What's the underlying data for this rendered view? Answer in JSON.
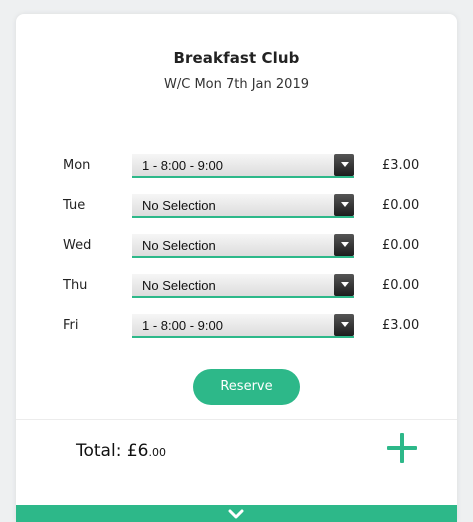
{
  "club": {
    "title": "Breakfast Club",
    "week": "W/C Mon 7th Jan 2019"
  },
  "days": [
    {
      "day": "Mon",
      "selection": "1 - 8:00 - 9:00",
      "price": "£3.00"
    },
    {
      "day": "Tue",
      "selection": "No Selection",
      "price": "£0.00"
    },
    {
      "day": "Wed",
      "selection": "No Selection",
      "price": "£0.00"
    },
    {
      "day": "Thu",
      "selection": "No Selection",
      "price": "£0.00"
    },
    {
      "day": "Fri",
      "selection": "1 - 8:00 - 9:00",
      "price": "£3.00"
    }
  ],
  "reserve_label": "Reserve",
  "total": {
    "label": "Total: £6",
    "cents": ".00"
  },
  "icons": {
    "add": "plus-icon",
    "expand": "chevron-down-icon"
  },
  "colors": {
    "accent": "#2db889"
  }
}
